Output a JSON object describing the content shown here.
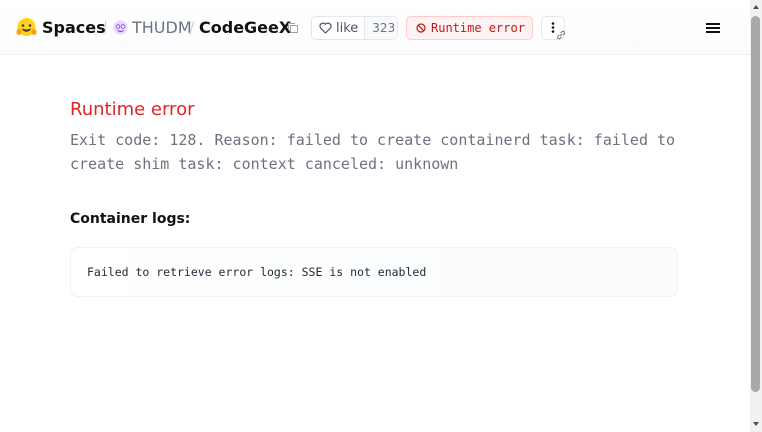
{
  "header": {
    "spaces_label": "Spaces",
    "org_name": "THUDM",
    "separator": "/",
    "space_name": "CodeGeeX",
    "like_label": "like",
    "like_count": "323",
    "status_label": "Runtime error"
  },
  "error": {
    "title": "Runtime error",
    "message": "Exit code: 128. Reason: failed to create containerd task: failed to create shim task: context canceled: unknown"
  },
  "logs": {
    "title": "Container logs:",
    "content": "Failed to retrieve error logs: SSE is not enabled"
  },
  "colors": {
    "error_red": "#e02424",
    "badge_bg": "#fef2f2",
    "badge_text": "#b91c1c",
    "muted_gray": "#6b7280"
  },
  "icons": [
    "hugging-face-logo-icon",
    "org-avatar-icon",
    "copy-icon",
    "heart-icon",
    "no-entry-icon",
    "more-vertical-icon",
    "link-icon",
    "hamburger-menu-icon"
  ]
}
